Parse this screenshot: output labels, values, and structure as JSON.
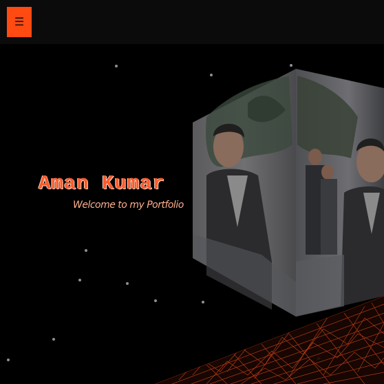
{
  "header": {
    "menu_icon_glyph": "☰"
  },
  "hero": {
    "name": "Aman Kumar",
    "tagline": "Welcome to my Portfolio"
  },
  "colors": {
    "accent": "#ff4a12",
    "title": "#ff5a2a",
    "subtitle": "#ffb08f",
    "background": "#000000",
    "topbar": "#0b0b0b"
  },
  "icons": {
    "menu": "hamburger-menu-icon"
  }
}
